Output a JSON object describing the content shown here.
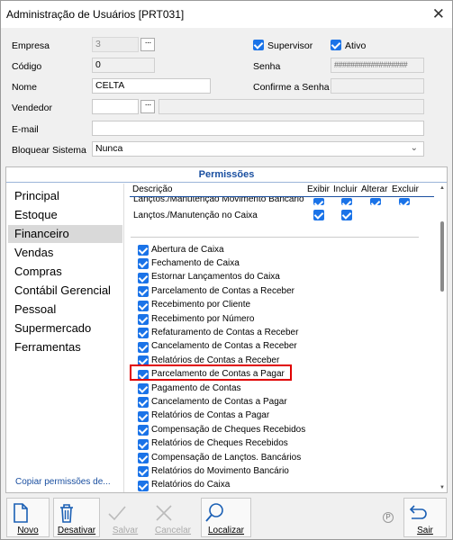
{
  "window": {
    "title": "Administração de Usuários [PRT031]",
    "close": "✕"
  },
  "form": {
    "empresa": {
      "label": "Empresa",
      "value": "3",
      "dots": "···"
    },
    "codigo": {
      "label": "Código",
      "value": "0"
    },
    "nome": {
      "label": "Nome",
      "value": "CELTA"
    },
    "vendedor": {
      "label": "Vendedor",
      "value": "",
      "dots": "···",
      "desc": ""
    },
    "email": {
      "label": "E-mail",
      "value": ""
    },
    "bloquear": {
      "label": "Bloquear Sistema",
      "value": "Nunca"
    },
    "supervisor": {
      "label": "Supervisor",
      "checked": true
    },
    "ativo": {
      "label": "Ativo",
      "checked": true
    },
    "senha": {
      "label": "Senha",
      "value": "##################"
    },
    "confirme": {
      "label": "Confirme a Senha",
      "value": ""
    }
  },
  "permissions": {
    "title": "Permissões",
    "categories": [
      "Principal",
      "Estoque",
      "Financeiro",
      "Vendas",
      "Compras",
      "Contábil Gerencial",
      "Pessoal",
      "Supermercado",
      "Ferramentas"
    ],
    "selected_category": "Financeiro",
    "copy_link": "Copiar permissões de...",
    "columns": {
      "descricao": "Descrição",
      "exibir": "Exibir",
      "incluir": "Incluir",
      "alterar": "Alterar",
      "excluir": "Excluir"
    },
    "top_rows": [
      {
        "label": "Lançtos./Manutenção Movimento Bancário",
        "exibir": true,
        "incluir": true,
        "alterar": true,
        "excluir": true
      },
      {
        "label": "Lançtos./Manutenção no Caixa",
        "exibir": true,
        "incluir": true,
        "alterar": false,
        "excluir": false
      }
    ],
    "items": [
      "Abertura de Caixa",
      "Fechamento de Caixa",
      "Estornar Lançamentos do Caixa",
      "Parcelamento de Contas a Receber",
      "Recebimento por Cliente",
      "Recebimento por Número",
      "Refaturamento de Contas a Receber",
      "Cancelamento de Contas a Receber",
      "Relatórios de Contas a Receber",
      "Parcelamento de Contas a Pagar",
      "Pagamento de Contas",
      "Cancelamento de Contas a Pagar",
      "Relatórios de Contas a Pagar",
      "Compensação de Cheques Recebidos",
      "Relatórios de Cheques Recebidos",
      "Compensação de Lançtos. Bancários",
      "Relatórios do Movimento Bancário",
      "Relatórios do Caixa"
    ],
    "highlighted_item": "Parcelamento de Contas a Pagar"
  },
  "toolbar": {
    "novo": "Novo",
    "desativar": "Desativar",
    "salvar": "Salvar",
    "cancelar": "Cancelar",
    "localizar": "Localizar",
    "sair": "Sair",
    "badge": "P"
  },
  "colors": {
    "accent": "#1a73e8",
    "highlight": "#e00000",
    "header_text": "#1a4fa0"
  }
}
